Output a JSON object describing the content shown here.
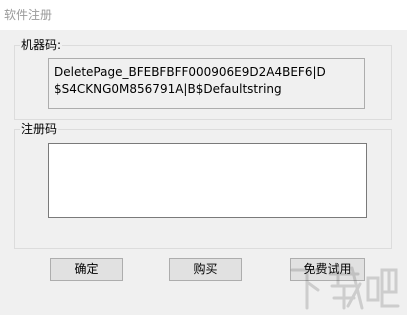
{
  "window": {
    "title": "软件注册"
  },
  "machine_code": {
    "label": "机器码:",
    "value": "DeletePage_BFEBFBFF000906E9D2A4BEF6|D\n$S4CKNG0M856791A|B$Defaultstring"
  },
  "registration_code": {
    "label": "注册码",
    "value": ""
  },
  "buttons": {
    "confirm_label": "确定",
    "buy_label": "购买",
    "free_trial_label": "免费试用"
  },
  "watermark": {
    "text": "下载吧"
  }
}
